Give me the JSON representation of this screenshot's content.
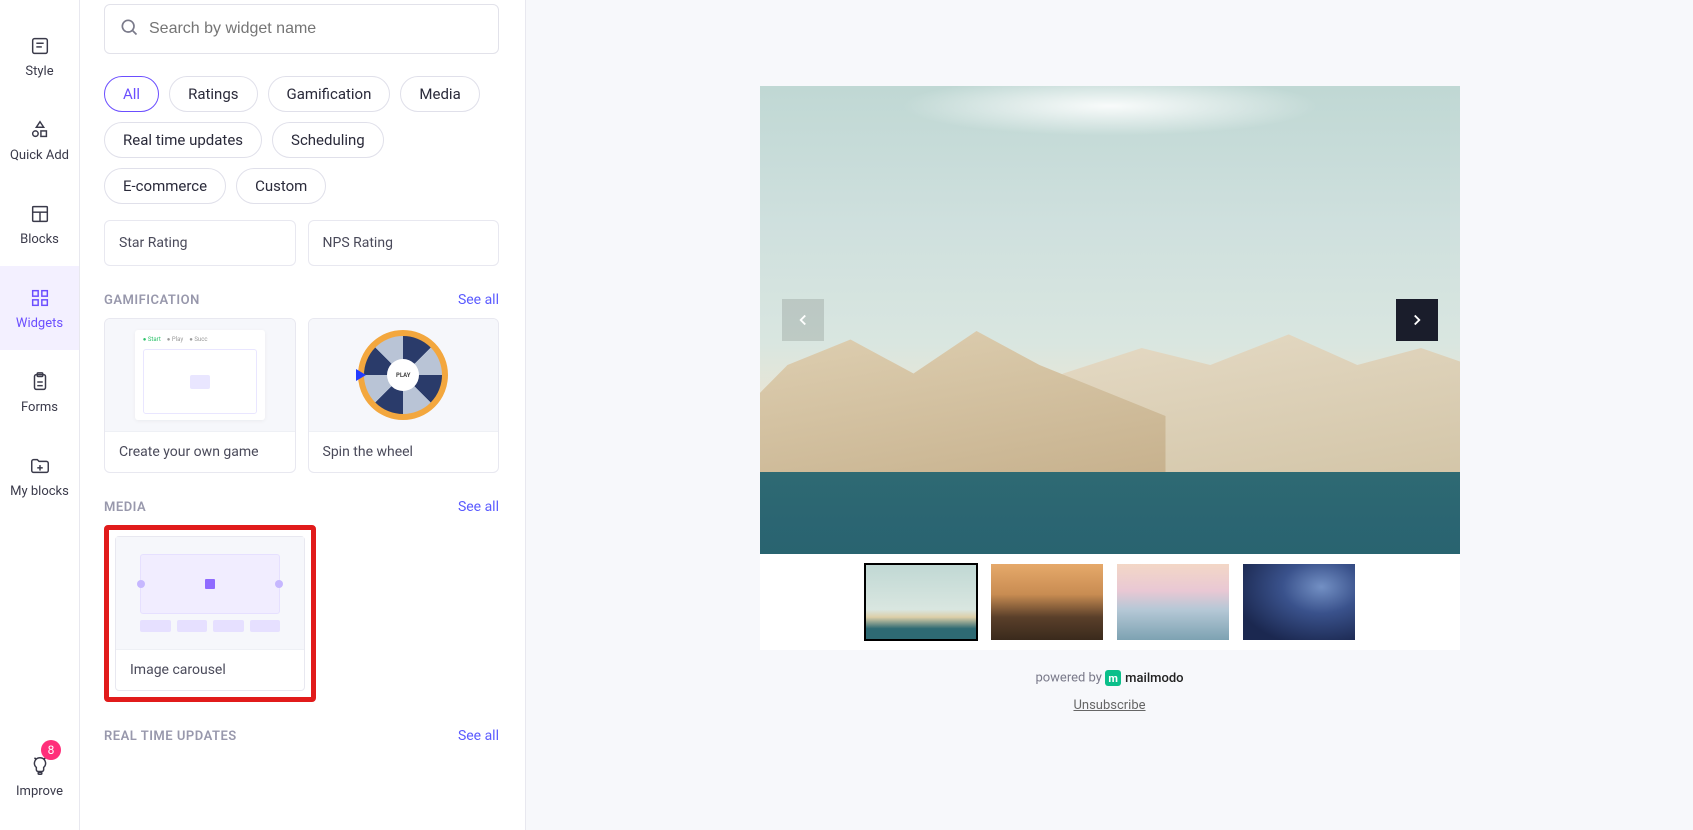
{
  "sidebar": {
    "items": [
      {
        "label": "Style"
      },
      {
        "label": "Quick Add"
      },
      {
        "label": "Blocks"
      },
      {
        "label": "Widgets"
      },
      {
        "label": "Forms"
      },
      {
        "label": "My blocks"
      }
    ],
    "improve": {
      "label": "Improve",
      "badge": "8"
    }
  },
  "search": {
    "placeholder": "Search by widget name"
  },
  "filters": [
    "All",
    "Ratings",
    "Gamification",
    "Media",
    "Real time updates",
    "Scheduling",
    "E-commerce",
    "Custom"
  ],
  "activeFilterIndex": 0,
  "ratingCards": [
    {
      "label": "Star Rating"
    },
    {
      "label": "NPS Rating"
    }
  ],
  "sections": {
    "gamification": {
      "title": "GAMIFICATION",
      "seeAll": "See all",
      "cards": [
        {
          "label": "Create your own game"
        },
        {
          "label": "Spin the wheel"
        }
      ]
    },
    "media": {
      "title": "MEDIA",
      "seeAll": "See all",
      "cards": [
        {
          "label": "Image carousel"
        }
      ]
    },
    "realtime": {
      "title": "REAL TIME UPDATES",
      "seeAll": "See all"
    }
  },
  "wheel": {
    "hubLabel": "PLAY"
  },
  "preview": {
    "poweredBy": "powered by",
    "brandName": "mailmodo",
    "brandGlyph": "m",
    "unsubscribe": "Unsubscribe"
  }
}
